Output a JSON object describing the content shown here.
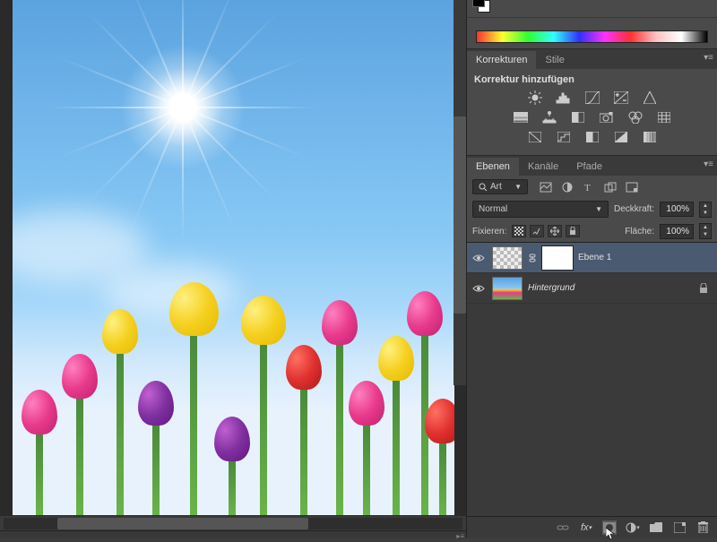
{
  "panels": {
    "adjustments": {
      "tabs": [
        "Korrekturen",
        "Stile"
      ],
      "active_tab": 0,
      "title": "Korrektur hinzufügen"
    },
    "layers": {
      "tabs": [
        "Ebenen",
        "Kanäle",
        "Pfade"
      ],
      "active_tab": 0
    }
  },
  "layers_panel": {
    "filter_label": "Art",
    "blend_mode": "Normal",
    "opacity_label": "Deckkraft:",
    "opacity_value": "100%",
    "lock_label": "Fixieren:",
    "fill_label": "Fläche:",
    "fill_value": "100%"
  },
  "layers": [
    {
      "name": "Ebene 1",
      "has_mask": true,
      "visible": true,
      "selected": true,
      "locked": false,
      "transparent": true,
      "italic": false
    },
    {
      "name": "Hintergrund",
      "has_mask": false,
      "visible": true,
      "selected": false,
      "locked": true,
      "transparent": false,
      "italic": true
    }
  ]
}
